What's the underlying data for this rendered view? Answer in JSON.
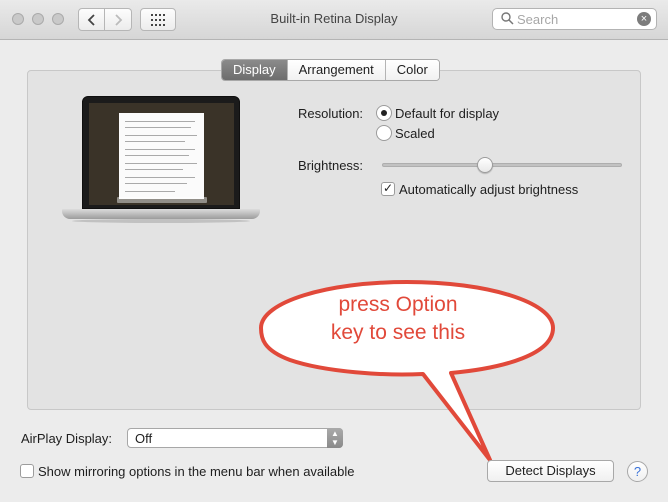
{
  "window": {
    "title": "Built-in Retina Display"
  },
  "toolbar": {
    "back_icon": "chevron-left-icon",
    "forward_icon": "chevron-right-icon",
    "grid_icon": "show-all-grid-icon"
  },
  "search": {
    "placeholder": "Search"
  },
  "tabs": [
    {
      "label": "Display",
      "active": true
    },
    {
      "label": "Arrangement",
      "active": false
    },
    {
      "label": "Color",
      "active": false
    }
  ],
  "resolution": {
    "label": "Resolution:",
    "options": [
      {
        "label": "Default for display",
        "selected": true
      },
      {
        "label": "Scaled",
        "selected": false
      }
    ]
  },
  "brightness": {
    "label": "Brightness:",
    "level": 0.43,
    "auto_label": "Automatically adjust brightness",
    "auto_checked": true
  },
  "airplay": {
    "label": "AirPlay Display:",
    "value": "Off"
  },
  "mirroring": {
    "label": "Show mirroring options in the menu bar when available",
    "checked": false
  },
  "detect_button": {
    "label": "Detect Displays"
  },
  "help_button": {
    "label": "?"
  },
  "callout": {
    "line1": "press Option",
    "line2": "key to see this",
    "color": "#e1493a"
  }
}
